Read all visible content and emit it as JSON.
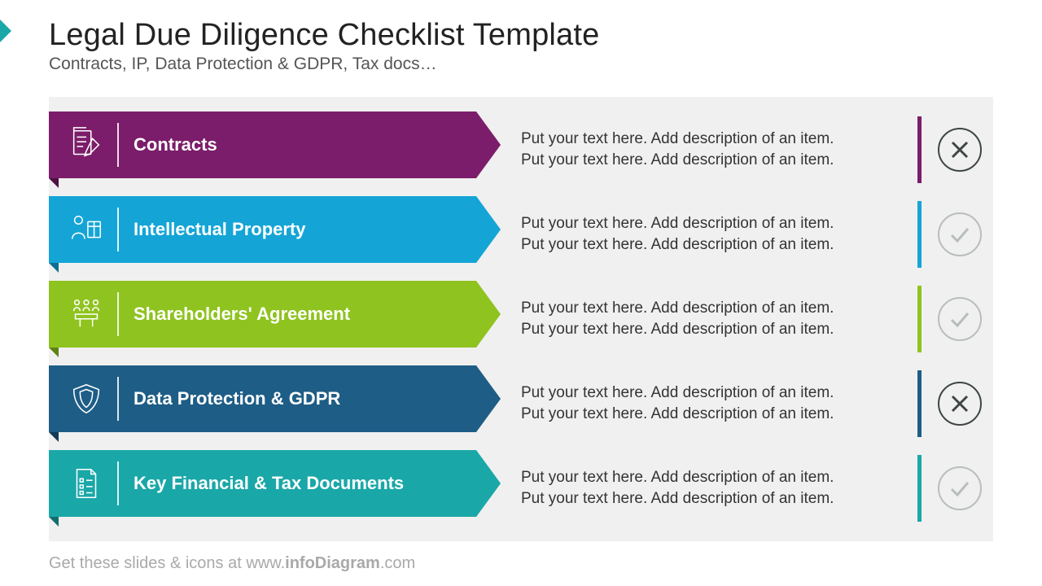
{
  "header": {
    "title": "Legal Due Diligence Checklist Template",
    "subtitle": "Contracts, IP, Data Protection & GDPR, Tax docs…"
  },
  "items": [
    {
      "title": "Contracts",
      "desc1": "Put your text here. Add description of an item.",
      "desc2": "Put your text here. Add description of an item.",
      "color": "#7b1d6a",
      "fold": "#4d1142",
      "status": "cross",
      "icon": "document-pencil"
    },
    {
      "title": "Intellectual Property",
      "desc1": "Put your text here. Add description of an item.",
      "desc2": "Put your text here. Add description of an item.",
      "color": "#14a5d6",
      "fold": "#0d6f90",
      "status": "check",
      "icon": "person-book"
    },
    {
      "title": "Shareholders' Agreement",
      "desc1": "Put your text here. Add description of an item.",
      "desc2": "Put your text here. Add description of an item.",
      "color": "#8fc31f",
      "fold": "#5f8214",
      "status": "check",
      "icon": "people-table"
    },
    {
      "title": "Data Protection & GDPR",
      "desc1": "Put your text here. Add description of an item.",
      "desc2": "Put your text here. Add description of an item.",
      "color": "#1e5d86",
      "fold": "#133b55",
      "status": "cross",
      "icon": "shield"
    },
    {
      "title": "Key Financial & Tax Documents",
      "desc1": "Put your text here. Add description of an item.",
      "desc2": "Put your text here. Add description of an item.",
      "color": "#1aa7a8",
      "fold": "#116e6f",
      "status": "check",
      "icon": "document-list"
    }
  ],
  "footer": {
    "prefix": "Get these slides & icons at www.",
    "brand": "infoDiagram",
    "suffix": ".com"
  }
}
